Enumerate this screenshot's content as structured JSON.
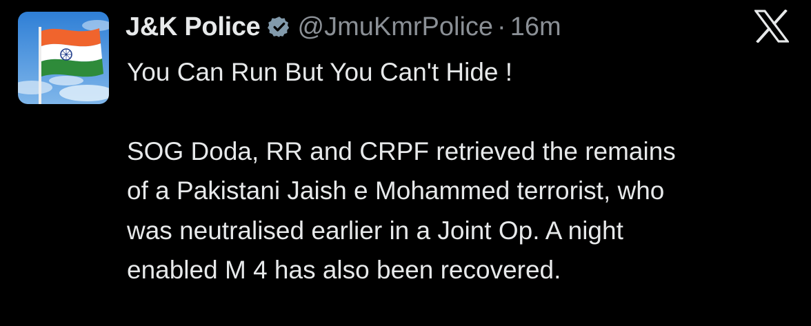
{
  "author": {
    "display_name": "J&K Police",
    "handle": "@JmuKmrPolice",
    "separator": "·",
    "time": "16m",
    "avatar_icon": "indian-flag-avatar",
    "verified_icon": "verified-badge-icon",
    "verified_color": "#829aab"
  },
  "platform": {
    "logo_icon": "x-logo-icon"
  },
  "tweet": {
    "line1": "You Can Run But You Can't Hide !",
    "body": [
      "SOG Doda, RR and CRPF retrieved the remains",
      "of a Pakistani Jaish e Mohammed terrorist, who",
      "was neutralised earlier in a Joint Op. A night",
      "enabled M 4 has also been recovered."
    ]
  },
  "colors": {
    "background": "#000000",
    "text": "#e7e9ea",
    "secondary_text": "#8b9096",
    "saffron": "#f0642d",
    "green": "#2e8b3a",
    "sky": "#4a8fd8"
  }
}
